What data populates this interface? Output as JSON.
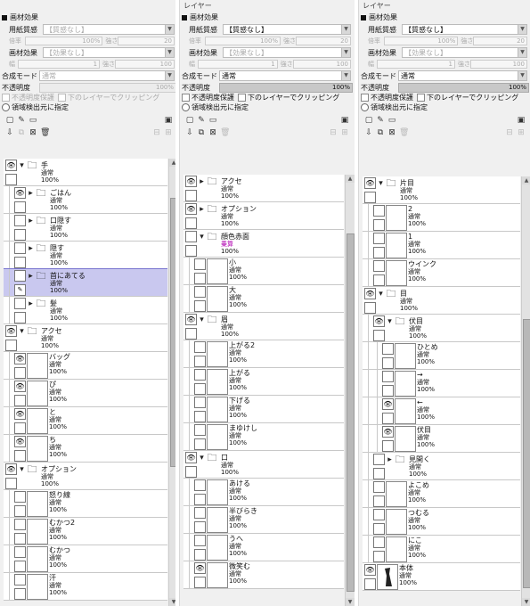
{
  "panels": [
    {
      "title": "",
      "section": "画材効果",
      "paper_label": "用紙質感",
      "paper_value": "【質感なし】",
      "paper_scale_label": "倍率",
      "paper_scale_value": "100%",
      "paper_strength_label": "強さ",
      "paper_strength_value": "20",
      "effect_label": "画材効果",
      "effect_value": "【効果なし】",
      "effect_width_label": "幅",
      "effect_width_value": "1",
      "effect_strength_label": "強さ",
      "effect_strength_value": "100",
      "mode_label": "合成モード",
      "mode_value": "通常",
      "opacity_label": "不透明度",
      "opacity_value": "100%",
      "opacity_disabled": true,
      "protect_label": "不透明度保護",
      "clip_label": "下のレイヤーでクリッピング",
      "detect_label": "領域検出元に指定",
      "layers": [
        {
          "type": "folder",
          "name": "手",
          "blend": "通常",
          "opacity": "100%",
          "indent": 0,
          "open": true,
          "eye": true
        },
        {
          "type": "folder",
          "name": "ごはん",
          "blend": "通常",
          "opacity": "100%",
          "indent": 1,
          "open": false,
          "eye": true
        },
        {
          "type": "folder",
          "name": "口隠す",
          "blend": "通常",
          "opacity": "100%",
          "indent": 1,
          "open": false,
          "eye": false
        },
        {
          "type": "folder",
          "name": "隠す",
          "blend": "通常",
          "opacity": "100%",
          "indent": 1,
          "open": false,
          "eye": false
        },
        {
          "type": "folder",
          "name": "首にあてる",
          "blend": "通常",
          "opacity": "100%",
          "indent": 1,
          "open": false,
          "eye": false,
          "selected": true
        },
        {
          "type": "folder",
          "name": "髪",
          "blend": "通常",
          "opacity": "100%",
          "indent": 1,
          "open": false,
          "eye": false
        },
        {
          "type": "folder",
          "name": "アクセ",
          "blend": "通常",
          "opacity": "100%",
          "indent": 0,
          "open": true,
          "eye": true
        },
        {
          "type": "layer",
          "name": "バッグ",
          "blend": "通常",
          "opacity": "100%",
          "indent": 1,
          "eye": true
        },
        {
          "type": "layer",
          "name": "ぴ",
          "blend": "通常",
          "opacity": "100%",
          "indent": 1,
          "eye": true
        },
        {
          "type": "layer",
          "name": "と",
          "blend": "通常",
          "opacity": "100%",
          "indent": 1,
          "eye": true
        },
        {
          "type": "layer",
          "name": "ち",
          "blend": "通常",
          "opacity": "100%",
          "indent": 1,
          "eye": true
        },
        {
          "type": "folder",
          "name": "オプション",
          "blend": "通常",
          "opacity": "100%",
          "indent": 0,
          "open": true,
          "eye": true
        },
        {
          "type": "layer",
          "name": "怒り線",
          "blend": "通常",
          "opacity": "100%",
          "indent": 1,
          "eye": false
        },
        {
          "type": "layer",
          "name": "むかつ2",
          "blend": "通常",
          "opacity": "100%",
          "indent": 1,
          "eye": false
        },
        {
          "type": "layer",
          "name": "むかつ",
          "blend": "通常",
          "opacity": "100%",
          "indent": 1,
          "eye": false
        },
        {
          "type": "layer",
          "name": "汗",
          "blend": "通常",
          "opacity": "100%",
          "indent": 1,
          "eye": false
        }
      ]
    },
    {
      "title": "レイヤー",
      "section": "画材効果",
      "paper_label": "用紙質感",
      "paper_value": "【質感なし】",
      "paper_scale_label": "倍率",
      "paper_scale_value": "100%",
      "paper_strength_label": "強さ",
      "paper_strength_value": "20",
      "effect_label": "画材効果",
      "effect_value": "【効果なし】",
      "effect_width_label": "幅",
      "effect_width_value": "1",
      "effect_strength_label": "強さ",
      "effect_strength_value": "100",
      "mode_label": "合成モード",
      "mode_value": "通常",
      "opacity_label": "不透明度",
      "opacity_value": "100%",
      "opacity_disabled": false,
      "protect_label": "不透明度保護",
      "clip_label": "下のレイヤーでクリッピング",
      "detect_label": "領域検出元に指定",
      "layers": [
        {
          "type": "folder",
          "name": "アクセ",
          "blend": "通常",
          "opacity": "100%",
          "indent": 0,
          "open": false,
          "eye": true
        },
        {
          "type": "folder",
          "name": "オプション",
          "blend": "通常",
          "opacity": "100%",
          "indent": 0,
          "open": false,
          "eye": true
        },
        {
          "type": "folder",
          "name": "顔色赤面",
          "blend": "乗算",
          "opacity": "100%",
          "indent": 0,
          "open": true,
          "eye": false,
          "mag": true
        },
        {
          "type": "layer",
          "name": "小",
          "blend": "通常",
          "opacity": "100%",
          "indent": 1,
          "eye": false
        },
        {
          "type": "layer",
          "name": "大",
          "blend": "通常",
          "opacity": "100%",
          "indent": 1,
          "eye": false
        },
        {
          "type": "folder",
          "name": "眉",
          "blend": "通常",
          "opacity": "100%",
          "indent": 0,
          "open": true,
          "eye": true
        },
        {
          "type": "layer",
          "name": "上がる2",
          "blend": "通常",
          "opacity": "100%",
          "indent": 1,
          "eye": false
        },
        {
          "type": "layer",
          "name": "上がる",
          "blend": "通常",
          "opacity": "100%",
          "indent": 1,
          "eye": false
        },
        {
          "type": "layer",
          "name": "下げる",
          "blend": "通常",
          "opacity": "100%",
          "indent": 1,
          "eye": false
        },
        {
          "type": "layer",
          "name": "まゆけし",
          "blend": "通常",
          "opacity": "100%",
          "indent": 1,
          "eye": false
        },
        {
          "type": "folder",
          "name": "口",
          "blend": "通常",
          "opacity": "100%",
          "indent": 0,
          "open": true,
          "eye": true
        },
        {
          "type": "layer",
          "name": "あける",
          "blend": "通常",
          "opacity": "100%",
          "indent": 1,
          "eye": false
        },
        {
          "type": "layer",
          "name": "半びらき",
          "blend": "通常",
          "opacity": "100%",
          "indent": 1,
          "eye": false
        },
        {
          "type": "layer",
          "name": "うへ",
          "blend": "通常",
          "opacity": "100%",
          "indent": 1,
          "eye": false
        },
        {
          "type": "layer",
          "name": "微笑む",
          "blend": "通常",
          "opacity": "100%",
          "indent": 1,
          "eye": true
        }
      ]
    },
    {
      "title": "レイヤー",
      "section": "画材効果",
      "paper_label": "用紙質感",
      "paper_value": "【質感なし】",
      "paper_scale_label": "倍率",
      "paper_scale_value": "100%",
      "paper_strength_label": "強さ",
      "paper_strength_value": "20",
      "effect_label": "画材効果",
      "effect_value": "【効果なし】",
      "effect_width_label": "幅",
      "effect_width_value": "1",
      "effect_strength_label": "強さ",
      "effect_strength_value": "100",
      "mode_label": "合成モード",
      "mode_value": "通常",
      "opacity_label": "不透明度",
      "opacity_value": "100%",
      "opacity_disabled": false,
      "protect_label": "不透明度保護",
      "clip_label": "下のレイヤーでクリッピング",
      "detect_label": "領域検出元に指定",
      "layers": [
        {
          "type": "folder",
          "name": "片目",
          "blend": "通常",
          "opacity": "100%",
          "indent": 0,
          "open": true,
          "eye": true
        },
        {
          "type": "layer",
          "name": "2",
          "blend": "通常",
          "opacity": "100%",
          "indent": 1,
          "eye": false
        },
        {
          "type": "layer",
          "name": "1",
          "blend": "通常",
          "opacity": "100%",
          "indent": 1,
          "eye": false
        },
        {
          "type": "layer",
          "name": "ウインク",
          "blend": "通常",
          "opacity": "100%",
          "indent": 1,
          "eye": false
        },
        {
          "type": "folder",
          "name": "目",
          "blend": "通常",
          "opacity": "100%",
          "indent": 0,
          "open": true,
          "eye": true
        },
        {
          "type": "folder",
          "name": "伏目",
          "blend": "通常",
          "opacity": "100%",
          "indent": 1,
          "open": true,
          "eye": true
        },
        {
          "type": "layer",
          "name": "ひとめ",
          "blend": "通常",
          "opacity": "100%",
          "indent": 2,
          "eye": false
        },
        {
          "type": "layer",
          "name": "→",
          "blend": "通常",
          "opacity": "100%",
          "indent": 2,
          "eye": false
        },
        {
          "type": "layer",
          "name": "←",
          "blend": "通常",
          "opacity": "100%",
          "indent": 2,
          "eye": true
        },
        {
          "type": "layer",
          "name": "伏目",
          "blend": "通常",
          "opacity": "100%",
          "indent": 2,
          "eye": true
        },
        {
          "type": "folder",
          "name": "見開く",
          "blend": "通常",
          "opacity": "100%",
          "indent": 1,
          "open": false,
          "eye": false
        },
        {
          "type": "layer",
          "name": "よこめ",
          "blend": "通常",
          "opacity": "100%",
          "indent": 1,
          "eye": false
        },
        {
          "type": "layer",
          "name": "つむる",
          "blend": "通常",
          "opacity": "100%",
          "indent": 1,
          "eye": false
        },
        {
          "type": "layer",
          "name": "にこ",
          "blend": "通常",
          "opacity": "100%",
          "indent": 1,
          "eye": false
        },
        {
          "type": "layer",
          "name": "本体",
          "blend": "通常",
          "opacity": "100%",
          "indent": 0,
          "eye": true,
          "figure": true
        }
      ]
    }
  ],
  "icons": {
    "new_layer": "new-layer-icon",
    "new_linework": "new-linework-icon",
    "new_folder": "new-folder-icon",
    "delete": "trash-icon",
    "eye": "eye-icon",
    "folder": "folder-icon"
  },
  "colors": {
    "selected_layer": "#c9c8ef",
    "selected_border": "#7a76cf",
    "blend_multiply": "#b000b0"
  }
}
